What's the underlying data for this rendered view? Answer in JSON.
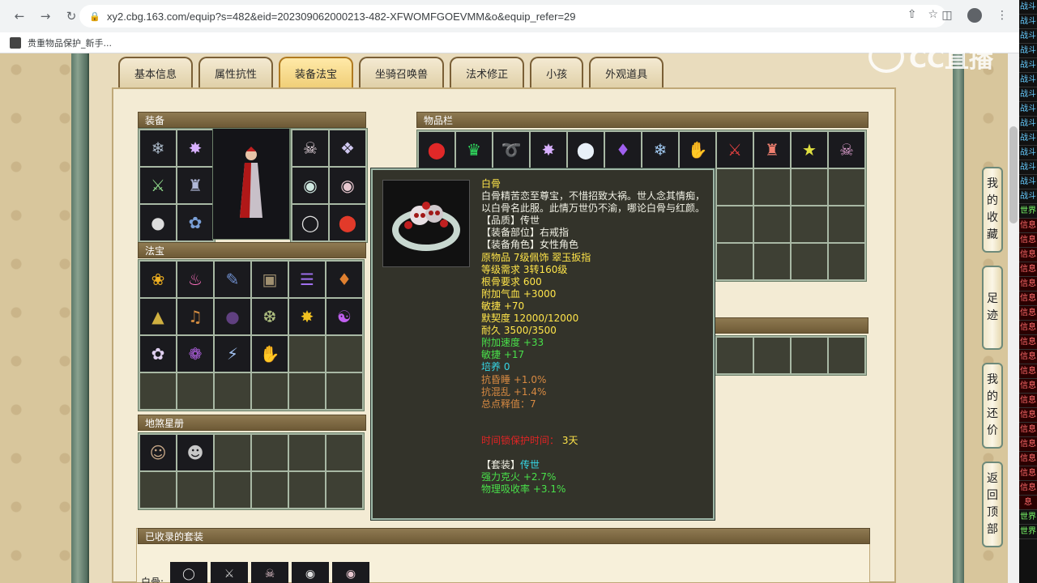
{
  "browser": {
    "url": "xy2.cbg.163.com/equip?s=482&eid=202309062000213-482-XFWOMFGOEVMM&o&equip_refer=29",
    "bookmark": "贵重物品保护_新手..."
  },
  "tabs": [
    "基本信息",
    "属性抗性",
    "装备法宝",
    "坐骑召唤兽",
    "法术修正",
    "小孩",
    "外观道具"
  ],
  "active_tab": "装备法宝",
  "sections": {
    "equipment": "装备",
    "fabao": "法宝",
    "disha": "地煞星册",
    "inventory": "物品栏",
    "collected_sets": "已收录的套装",
    "bone_label": "白骨:"
  },
  "tooltip": {
    "name": "白骨",
    "description": "白骨精苦恋至尊宝，不惜招致大祸。世人念其情痴，以白骨名此服。此情万世仍不渝，哪论白骨与红颜。",
    "quality": "【品质】传世",
    "slot": "【装备部位】右戒指",
    "role": "【装备角色】女性角色",
    "origin": "原物品 7级佩饰 翠玉扳指",
    "level_req": "等级需求 3转160级",
    "bone_req": "根骨要求 600",
    "hp_bonus": "附加气血 +3000",
    "agility": "敏捷 +70",
    "affinity": "默契度 12000/12000",
    "durability": "耐久 3500/3500",
    "speed_bonus": "附加速度 +33",
    "agility2": "敏捷 +17",
    "cultivate": "培养 0",
    "resist_seal": "抗昏睡 +1.0%",
    "resist_chaos": "抗混乱 +1.4%",
    "total_score": "总点释值：7",
    "protect_label": "时间锁保护时间：",
    "protect_value": "3天",
    "set_label": "【套装】",
    "set_value": "传世",
    "ke_huo": "强力克火 +2.7%",
    "phys_absorb": "物理吸收率 +3.1%"
  },
  "float_buttons": {
    "favorites": [
      "我",
      "的",
      "收",
      "藏"
    ],
    "footprint": [
      "足",
      "迹"
    ],
    "bargain": [
      "我",
      "的",
      "还",
      "价"
    ],
    "top": [
      "返",
      "回",
      "顶",
      "部"
    ]
  },
  "watermark": "CC直播",
  "strip_tags": [
    "战斗",
    "战斗",
    "战斗",
    "战斗",
    "战斗",
    "战斗",
    "战斗",
    "战斗",
    "战斗",
    "战斗",
    "战斗",
    "战斗",
    "战斗",
    "战斗",
    "世界",
    "信息",
    "信息",
    "信息",
    "信息",
    "信息",
    "信息",
    "信息",
    "信息",
    "信息",
    "信息",
    "信息",
    "信息",
    "信息",
    "信息",
    "信息",
    "信息",
    "信息",
    "信息",
    "信息",
    "息",
    "世界",
    "世界"
  ],
  "colors": {
    "tooltip_bg": "#33332a",
    "name_color": "#ffe54a",
    "green_attr": "#49e04a",
    "orange_attr": "#d88a42",
    "red_attr": "#e02424"
  }
}
